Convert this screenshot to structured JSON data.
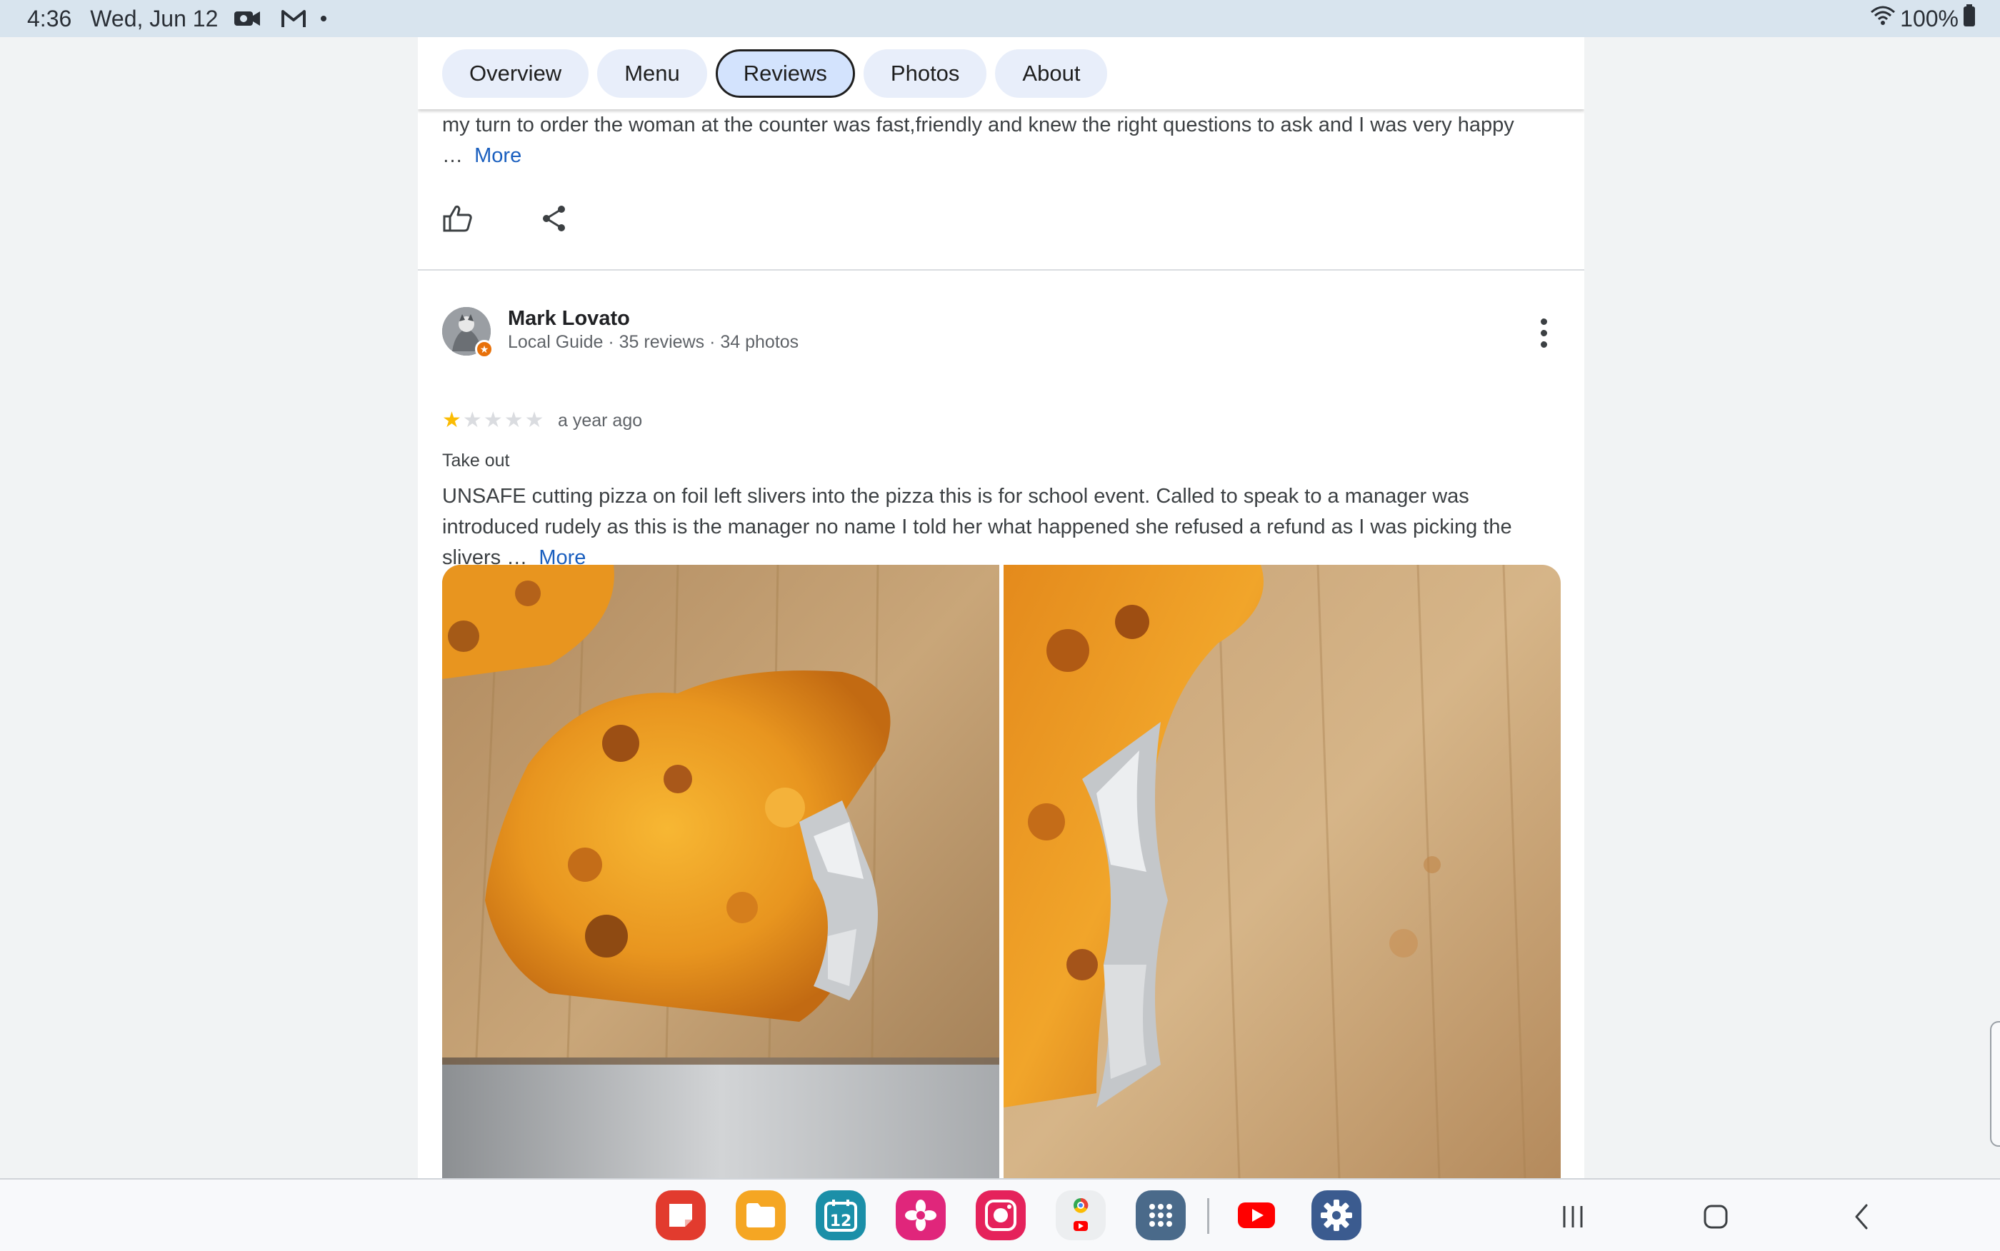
{
  "status_bar": {
    "time": "4:36",
    "date": "Wed, Jun 12",
    "icons": [
      "video-camera-icon",
      "gmail-icon",
      "notification-dot-icon"
    ],
    "battery": "100%",
    "right_icons": [
      "wifi-icon",
      "battery-icon"
    ]
  },
  "tabs": [
    {
      "label": "Overview",
      "active": false
    },
    {
      "label": "Menu",
      "active": false
    },
    {
      "label": "Reviews",
      "active": true
    },
    {
      "label": "Photos",
      "active": false
    },
    {
      "label": "About",
      "active": false
    }
  ],
  "previous_review": {
    "text": "my turn to order the woman at the counter was fast,friendly and knew the right questions to ask and I was very happy",
    "ellipsis": "…",
    "more_label": "More",
    "actions": [
      "thumbs-up-icon",
      "share-icon"
    ]
  },
  "review": {
    "author": "Mark Lovato",
    "meta": "Local Guide · 35 reviews · 34 photos",
    "rating": 1,
    "max_rating": 5,
    "date": "a year ago",
    "service": "Take out",
    "text": "UNSAFE cutting pizza on foil left slivers into the pizza this is for school event. Called to speak to a manager was introduced rudely as this is the manager no name I told her what happened she refused a refund as I was picking the slivers",
    "ellipsis": "…",
    "more_label": "More",
    "photos": [
      "pizza-slice-on-foil-photo",
      "pizza-edge-on-foil-photo"
    ]
  },
  "taskbar": {
    "apps": [
      {
        "name": "samsung-notes-icon",
        "color": "#e23b2e"
      },
      {
        "name": "my-files-icon",
        "color": "#f5a623"
      },
      {
        "name": "calendar-icon",
        "color": "#1b8fa8",
        "label": "12"
      },
      {
        "name": "gallery-icon",
        "color": "#e0267b"
      },
      {
        "name": "screen-recorder-icon",
        "color": "#e5225b"
      },
      {
        "name": "chrome-youtube-folder-icon",
        "color": "#f1f3f4"
      },
      {
        "name": "app-drawer-icon",
        "color": "#4a6a8a"
      },
      {
        "name": "youtube-icon",
        "color": "#ff0000"
      },
      {
        "name": "settings-icon",
        "color": "#3b5b8f"
      }
    ],
    "nav": [
      "recent-apps-icon",
      "home-icon",
      "back-icon"
    ]
  }
}
